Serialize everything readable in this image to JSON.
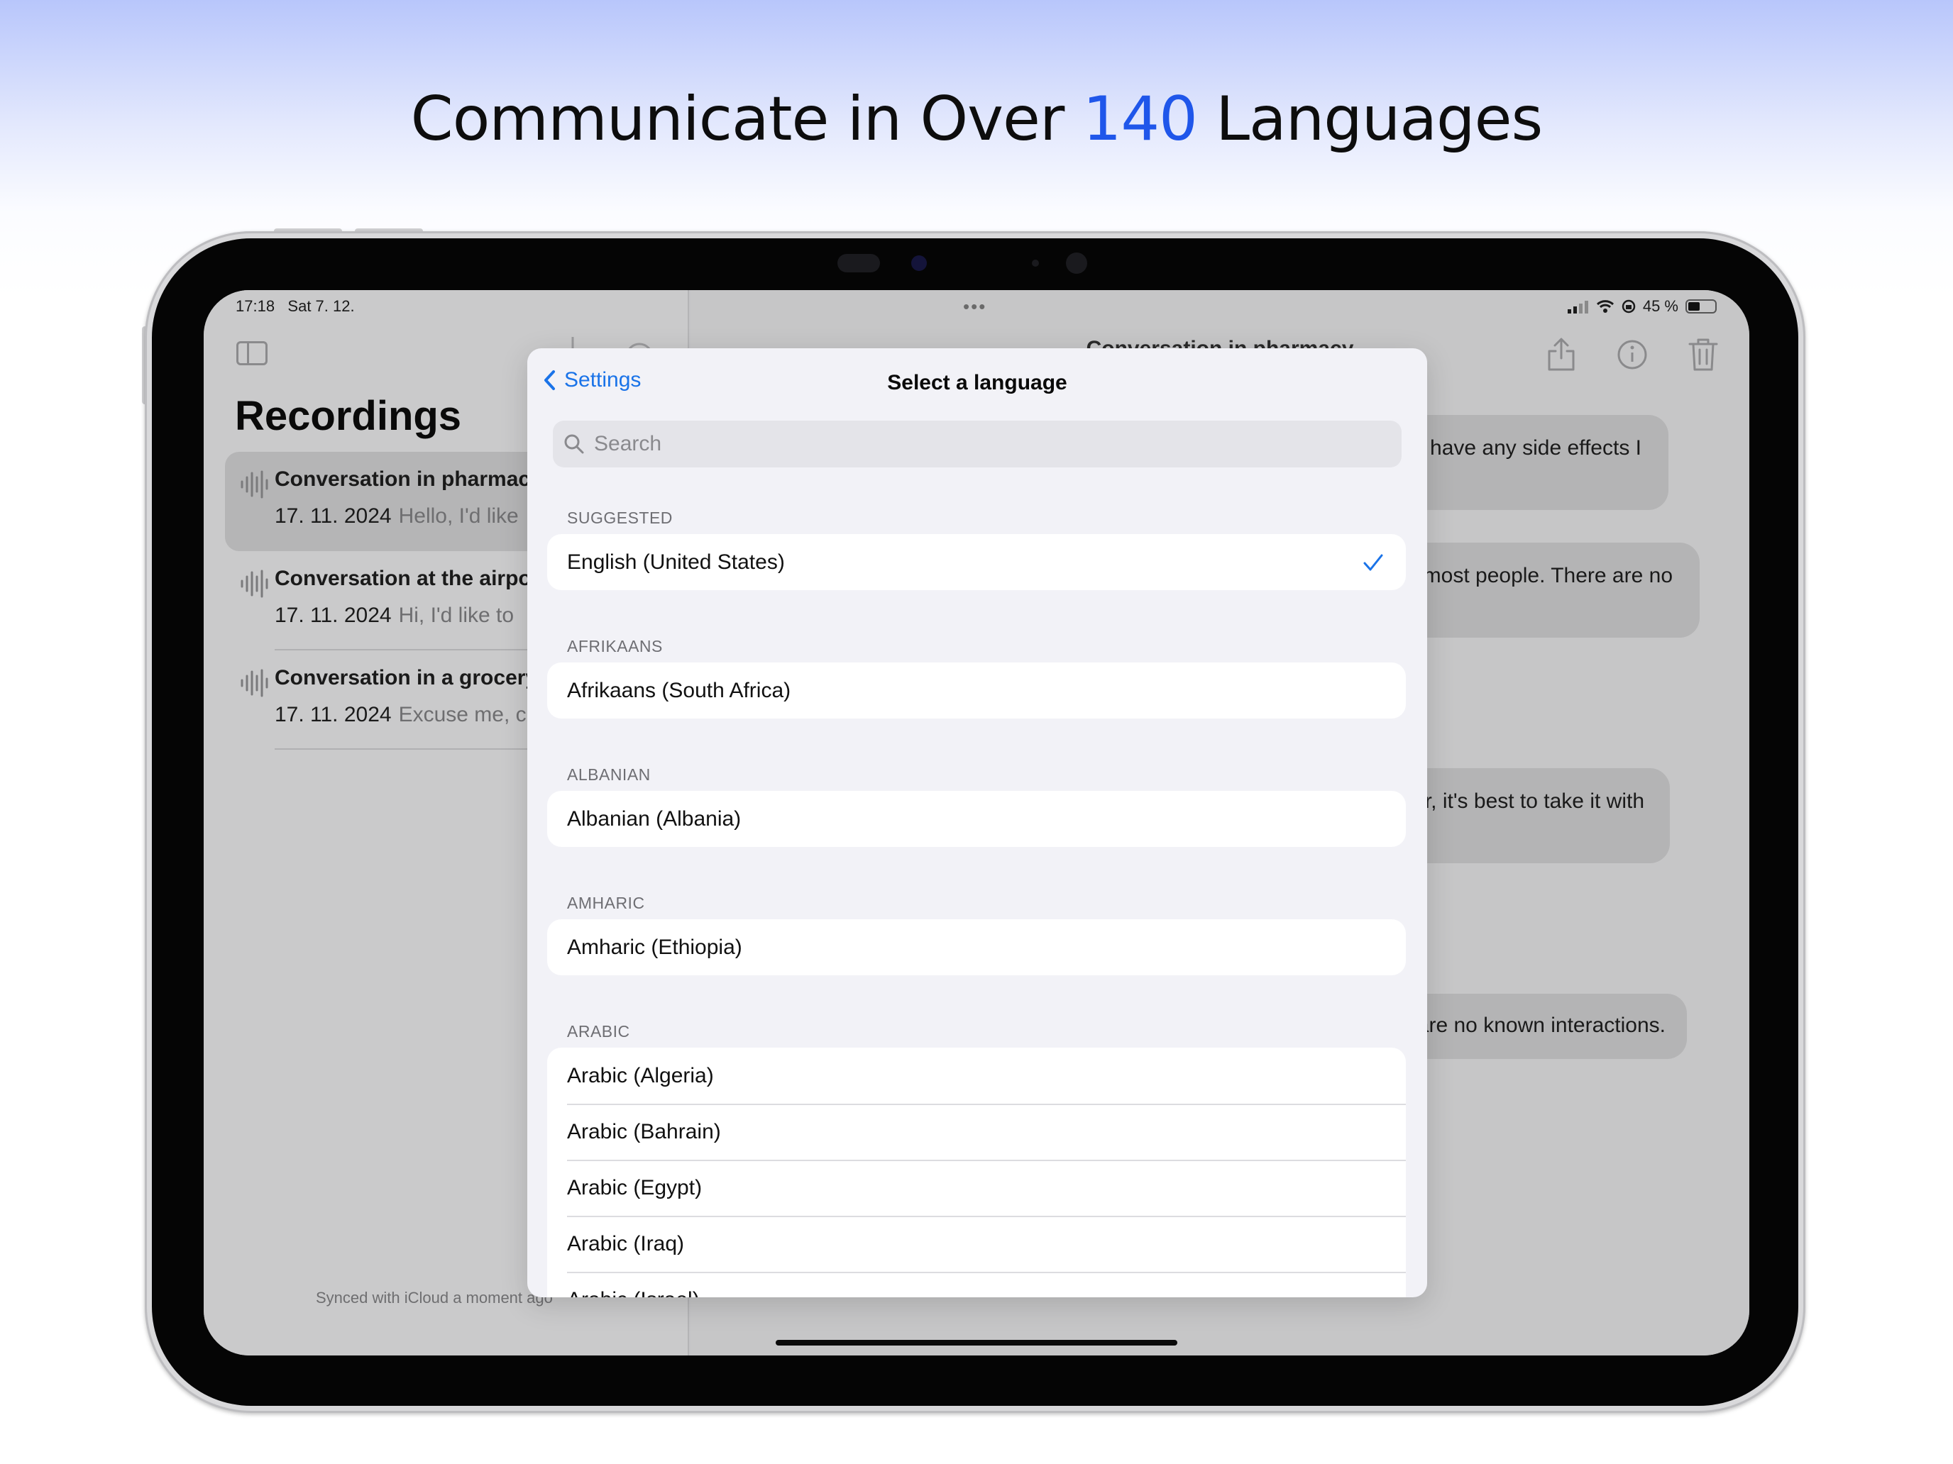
{
  "headline": {
    "before": "Communicate in Over ",
    "accent": "140",
    "after": " Languages"
  },
  "colors": {
    "accent_headline": "#1f56ea",
    "ios_blue": "#1a73e8",
    "sheet_bg": "#f2f2f7"
  },
  "status_bar": {
    "time": "17:18",
    "date": "Sat 7. 12.",
    "battery": "45 %",
    "dots": "•••"
  },
  "sidebar": {
    "title": "Recordings",
    "items": [
      {
        "name": "Conversation in pharmacy",
        "date": "17. 11. 2024",
        "preview": "Hello, I'd like"
      },
      {
        "name": "Conversation at the airport",
        "date": "17. 11. 2024",
        "preview": "Hi, I'd like to"
      },
      {
        "name": "Conversation in a grocery",
        "date": "17. 11. 2024",
        "preview": "Excuse me, c"
      }
    ],
    "synced": "Synced with iCloud a moment ago"
  },
  "detail": {
    "title": "Conversation in pharmacy",
    "bubbles": [
      "it have any side effects I",
      "r most people. There are no",
      "r, it's best to take it with",
      "are no known interactions."
    ]
  },
  "sheet": {
    "back_label": "Settings",
    "title": "Select a language",
    "search_placeholder": "Search",
    "sections": [
      {
        "header": "SUGGESTED",
        "rows": [
          "English (United States)"
        ]
      },
      {
        "header": "AFRIKAANS",
        "rows": [
          "Afrikaans (South Africa)"
        ]
      },
      {
        "header": "ALBANIAN",
        "rows": [
          "Albanian (Albania)"
        ]
      },
      {
        "header": "AMHARIC",
        "rows": [
          "Amharic (Ethiopia)"
        ]
      },
      {
        "header": "ARABIC",
        "rows": [
          "Arabic (Algeria)",
          "Arabic (Bahrain)",
          "Arabic (Egypt)",
          "Arabic (Iraq)",
          "Arabic (Israel)"
        ]
      }
    ],
    "selected": "English (United States)"
  }
}
